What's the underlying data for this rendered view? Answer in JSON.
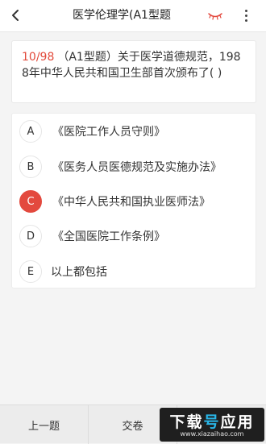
{
  "header": {
    "title": "医学伦理学(A1型题",
    "back_icon": "chevron-left-icon",
    "eye_icon": "eye-closed-icon",
    "more_icon": "more-vertical-icon",
    "eye_color": "#e3493e"
  },
  "question": {
    "index": "10/98",
    "text": "（A1型题）关于医学道德规范，1988年中华人民共和国卫生部首次颁布了(    )"
  },
  "options": [
    {
      "letter": "A",
      "text": "《医院工作人员守则》",
      "selected": false
    },
    {
      "letter": "B",
      "text": "《医务人员医德规范及实施办法》",
      "selected": false
    },
    {
      "letter": "C",
      "text": "《中华人民共和国执业医师法》",
      "selected": true
    },
    {
      "letter": "D",
      "text": "《全国医院工作条例》",
      "selected": false
    },
    {
      "letter": "E",
      "text": "以上都包括",
      "selected": false
    }
  ],
  "footer": {
    "prev_label": "上一题",
    "submit_label": "交卷"
  },
  "watermark": {
    "main_a": "下载",
    "main_b": "号",
    "main_c": "应用",
    "url": "www.xiazaihao.com"
  },
  "colors": {
    "accent": "#e3493e",
    "index_red": "#e24a3b"
  }
}
